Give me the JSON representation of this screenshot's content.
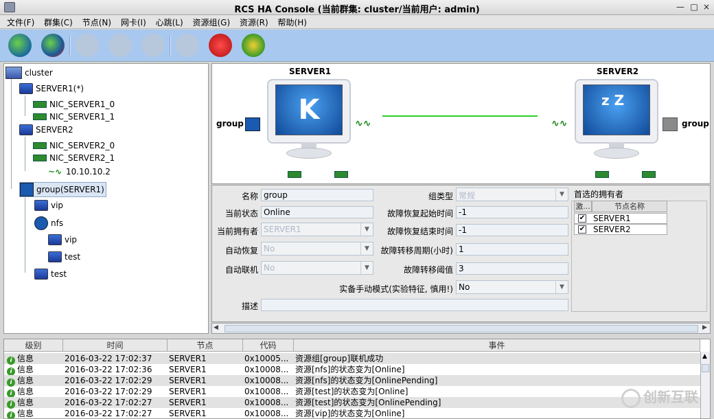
{
  "window": {
    "title": "RCS HA Console (当前群集: cluster/当前用户: admin)",
    "minimize": "—",
    "maximize": "□",
    "close": "×"
  },
  "menu": [
    "文件(F)",
    "群集(C)",
    "节点(N)",
    "网卡(I)",
    "心跳(L)",
    "资源组(G)",
    "资源(R)",
    "帮助(H)"
  ],
  "tree": {
    "cluster": "cluster",
    "server1": "SERVER1(*)",
    "nic_s1_0": "NIC_SERVER1_0",
    "nic_s1_1": "NIC_SERVER1_1",
    "server2": "SERVER2",
    "nic_s2_0": "NIC_SERVER2_0",
    "nic_s2_1": "NIC_SERVER2_1",
    "ip": "10.10.10.2",
    "group": "group(SERVER1)",
    "vip": "vip",
    "nfs": "nfs",
    "nfs_vip": "vip",
    "nfs_test": "test",
    "test": "test"
  },
  "topology": {
    "server1": "SERVER1",
    "server2": "SERVER2",
    "group_left": "group",
    "group_right": "group"
  },
  "props": {
    "name_label": "名称",
    "name_value": "group",
    "state_label": "当前状态",
    "state_value": "Online",
    "owner_label": "当前拥有者",
    "owner_value": "SERVER1",
    "autorecover_label": "自动恢复",
    "autorecover_value": "No",
    "autoonline_label": "自动联机",
    "autoonline_value": "No",
    "type_label": "组类型",
    "type_value": "常规",
    "fb_start_label": "故障恢复起始时间",
    "fb_start_value": "-1",
    "fb_end_label": "故障恢复结束时间",
    "fb_end_value": "-1",
    "fo_period_label": "故障转移周期(小时)",
    "fo_period_value": "1",
    "fo_threshold_label": "故障转移阈值",
    "fo_threshold_value": "3",
    "manual_label": "实备手动模式(实验特征, 慎用!)",
    "manual_value": "No",
    "desc_label": "描述",
    "desc_value": ""
  },
  "owners": {
    "title": "首选的拥有者",
    "col_active": "激...",
    "col_name": "节点名称",
    "rows": [
      "SERVER1",
      "SERVER2"
    ]
  },
  "log": {
    "headers": [
      "级别",
      "时间",
      "节点",
      "代码",
      "事件"
    ],
    "rows": [
      {
        "level": "信息",
        "time": "2016-03-22 17:02:37",
        "node": "SERVER1",
        "code": "0x10005...",
        "event": "资源组[group]联机成功"
      },
      {
        "level": "信息",
        "time": "2016-03-22 17:02:36",
        "node": "SERVER1",
        "code": "0x10008...",
        "event": "资源[nfs]的状态变为[Online]"
      },
      {
        "level": "信息",
        "time": "2016-03-22 17:02:29",
        "node": "SERVER1",
        "code": "0x10008...",
        "event": "资源[nfs]的状态变为[OnlinePending]"
      },
      {
        "level": "信息",
        "time": "2016-03-22 17:02:29",
        "node": "SERVER1",
        "code": "0x10008...",
        "event": "资源[test]的状态变为[Online]"
      },
      {
        "level": "信息",
        "time": "2016-03-22 17:02:27",
        "node": "SERVER1",
        "code": "0x10008...",
        "event": "资源[test]的状态变为[OnlinePending]"
      },
      {
        "level": "信息",
        "time": "2016-03-22 17:02:27",
        "node": "SERVER1",
        "code": "0x10008...",
        "event": "资源[vip]的状态变为[Online]"
      }
    ]
  },
  "watermark": "创新互联"
}
